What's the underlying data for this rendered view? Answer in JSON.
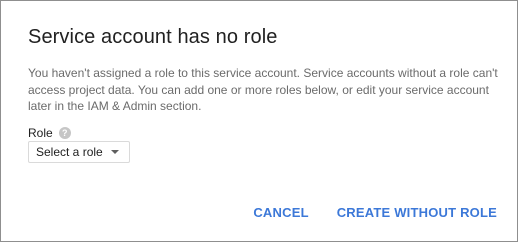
{
  "dialog": {
    "title": "Service account has no role",
    "body": "You haven't assigned a role to this service account. Service accounts without a role can't access project data. You can add one or more roles below, or edit your service account later in the IAM & Admin section.",
    "role_label": "Role",
    "help_icon_glyph": "?",
    "role_select": {
      "value": "Select a role"
    },
    "actions": {
      "cancel_label": "CANCEL",
      "create_label": "CREATE WITHOUT ROLE"
    }
  },
  "icons": {
    "help": "help-icon",
    "dropdown": "chevron-down-icon"
  },
  "colors": {
    "accent": "#3c78d8",
    "title": "#212121",
    "body_text": "#6b6b6b",
    "help_icon": "#c6c6c6"
  }
}
